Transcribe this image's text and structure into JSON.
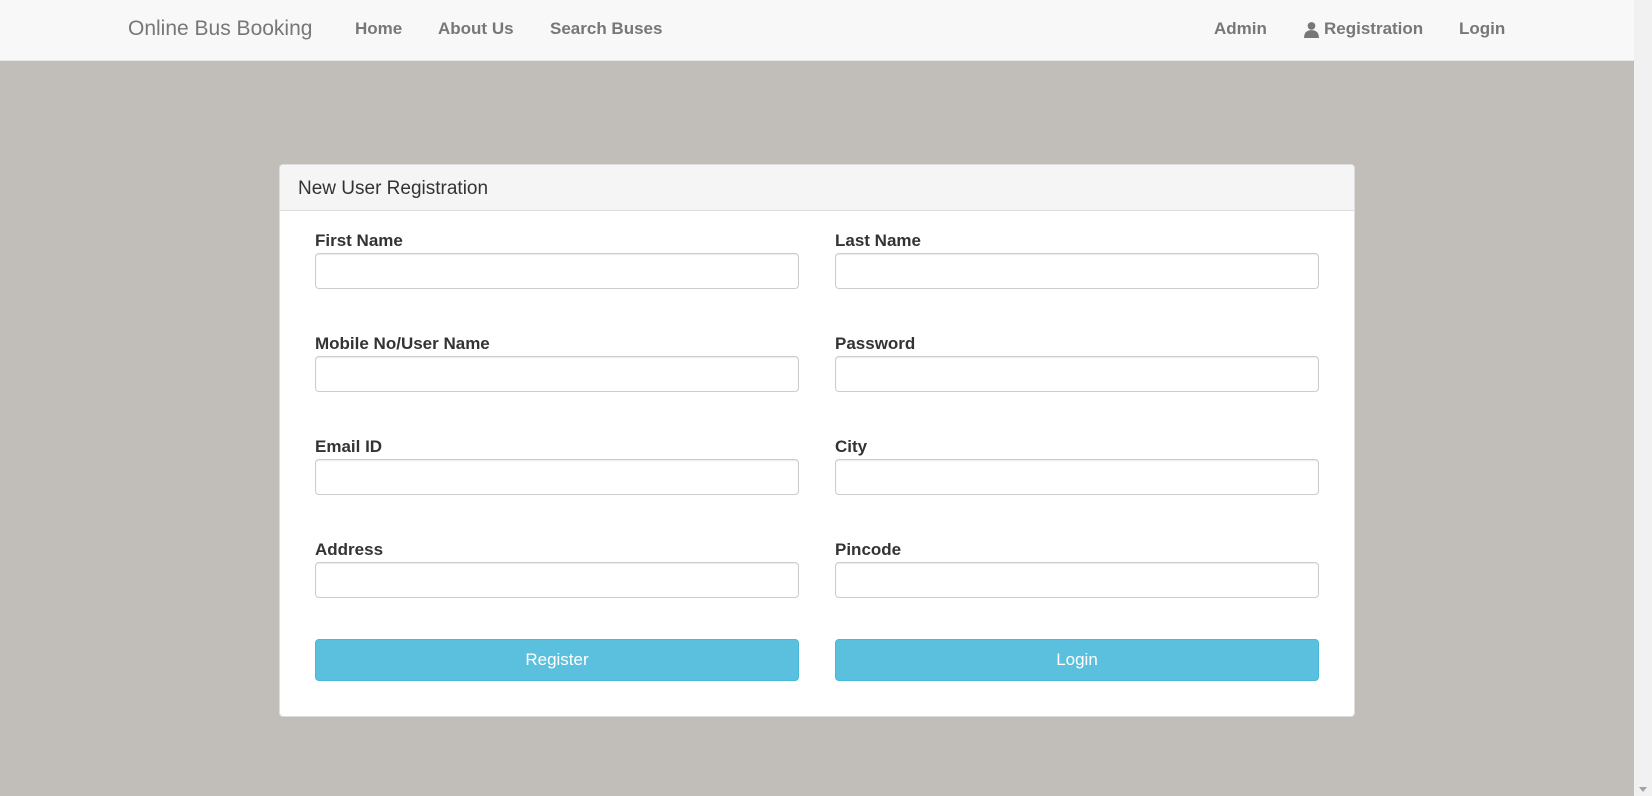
{
  "navbar": {
    "brand": "Online Bus Booking",
    "left_links": [
      "Home",
      "About Us",
      "Search Buses"
    ],
    "right_links": {
      "admin": "Admin",
      "registration": "Registration",
      "login": "Login"
    }
  },
  "form": {
    "title": "New User Registration",
    "fields": {
      "first_name": {
        "label": "First Name",
        "value": ""
      },
      "last_name": {
        "label": "Last Name",
        "value": ""
      },
      "mobile": {
        "label": "Mobile No/User Name",
        "value": ""
      },
      "password": {
        "label": "Password",
        "value": ""
      },
      "email": {
        "label": "Email ID",
        "value": ""
      },
      "city": {
        "label": "City",
        "value": ""
      },
      "address": {
        "label": "Address",
        "value": ""
      },
      "pincode": {
        "label": "Pincode",
        "value": ""
      }
    },
    "buttons": {
      "register": "Register",
      "login": "Login"
    }
  },
  "colors": {
    "page_background": "#c1bdb9",
    "navbar_background": "#f8f8f8",
    "button_info": "#5bc0de"
  },
  "icons": {
    "registration": "user-icon"
  }
}
